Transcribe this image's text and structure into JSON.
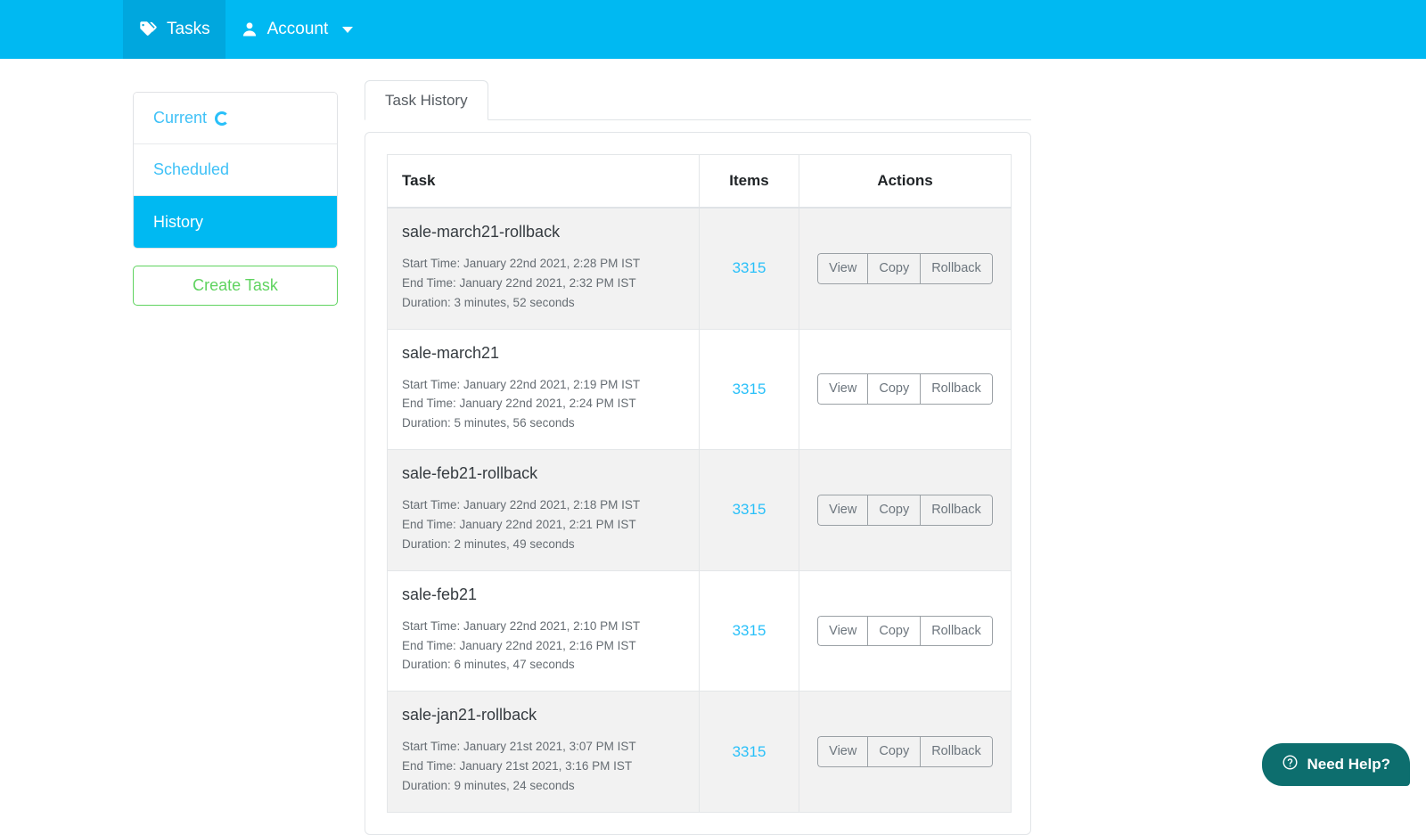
{
  "navbar": {
    "bg_color": "#00b9f2",
    "items": [
      {
        "label": "Tasks",
        "icon": "tag-icon",
        "active": true
      },
      {
        "label": "Account",
        "icon": "user-icon",
        "active": false,
        "has_caret": true
      }
    ]
  },
  "sidebar": {
    "items": [
      {
        "label": "Current",
        "icon": "spinner-icon",
        "active": false
      },
      {
        "label": "Scheduled",
        "icon": "",
        "active": false
      },
      {
        "label": "History",
        "icon": "",
        "active": true
      }
    ],
    "create_button_label": "Create Task",
    "active_color": "#00b9f2",
    "link_color": "#3fc1f7",
    "create_button_color": "#5fd35f"
  },
  "tabs": [
    {
      "label": "Task History",
      "active": true
    }
  ],
  "table": {
    "headers": {
      "task": "Task",
      "items": "Items",
      "actions": "Actions"
    },
    "action_labels": {
      "view": "View",
      "copy": "Copy",
      "rollback": "Rollback"
    },
    "rows": [
      {
        "name": "sale-march21-rollback",
        "start_time": "Start Time: January 22nd 2021, 2:28 PM IST",
        "end_time": "End Time: January 22nd 2021, 2:32 PM IST",
        "duration": "Duration: 3 minutes, 52 seconds",
        "items": "3315"
      },
      {
        "name": "sale-march21",
        "start_time": "Start Time: January 22nd 2021, 2:19 PM IST",
        "end_time": "End Time: January 22nd 2021, 2:24 PM IST",
        "duration": "Duration: 5 minutes, 56 seconds",
        "items": "3315"
      },
      {
        "name": "sale-feb21-rollback",
        "start_time": "Start Time: January 22nd 2021, 2:18 PM IST",
        "end_time": "End Time: January 22nd 2021, 2:21 PM IST",
        "duration": "Duration: 2 minutes, 49 seconds",
        "items": "3315"
      },
      {
        "name": "sale-feb21",
        "start_time": "Start Time: January 22nd 2021, 2:10 PM IST",
        "end_time": "End Time: January 22nd 2021, 2:16 PM IST",
        "duration": "Duration: 6 minutes, 47 seconds",
        "items": "3315"
      },
      {
        "name": "sale-jan21-rollback",
        "start_time": "Start Time: January 21st 2021, 3:07 PM IST",
        "end_time": "End Time: January 21st 2021, 3:16 PM IST",
        "duration": "Duration: 9 minutes, 24 seconds",
        "items": "3315"
      }
    ],
    "items_link_color": "#29c0f9"
  },
  "help_widget": {
    "label": "Need Help?",
    "icon": "question-circle-icon",
    "bg_color": "#0d6e6e"
  }
}
